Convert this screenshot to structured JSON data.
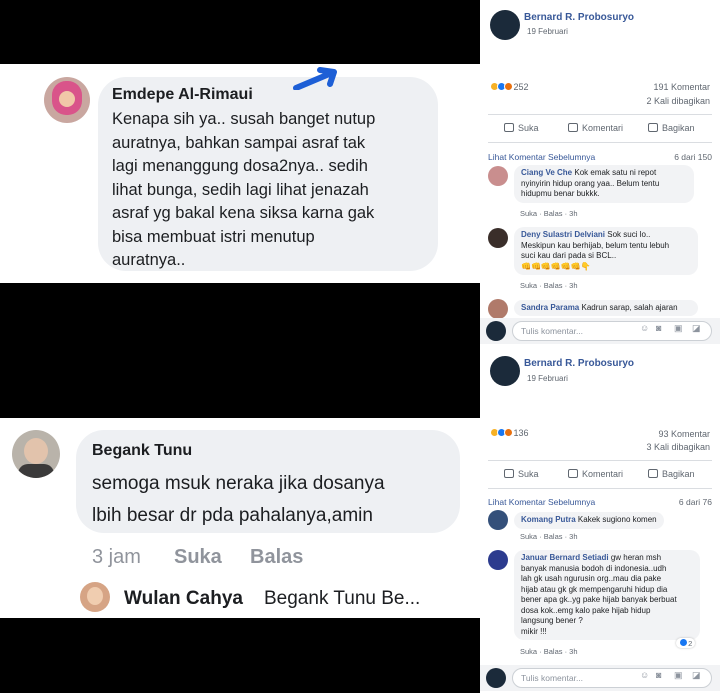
{
  "left_top": {
    "name": "Emdepe Al-Rimaui",
    "text": "Kenapa sih ya.. susah banget nutup\nauratnya, bahkan sampai asraf tak\nlagi menanggung dosa2nya.. sedih\nlihat bunga, sedih lagi lihat jenazah\nasraf yg bakal kena siksa karna gak\nbisa membuat istri menutup\nauratnya.."
  },
  "left_bottom": {
    "name": "Begank Tunu",
    "text": "semoga msuk neraka jika dosanya\nlbih besar dr pda pahalanya,amin",
    "time": "3 jam",
    "like": "Suka",
    "reply": "Balas",
    "next_name": "Wulan Cahya",
    "next_text": "Begank Tunu Be..."
  },
  "posts": [
    {
      "author": "Bernard R. Probosuryo",
      "date": "19 Februari",
      "reactions": "252",
      "comments": "191 Komentar",
      "shares": "2 Kali dibagikan",
      "like": "Suka",
      "comment": "Komentari",
      "share": "Bagikan",
      "prev": "Lihat Komentar Sebelumnya",
      "pages": "6 dari 150",
      "items": [
        {
          "name": "Ciang Ve Che",
          "text": "Kok emak satu ni repot\nnyinyirin hidup orang yaa.. Belum tentu\nhidupmu benar bukkk.",
          "meta": "Suka · Balas · 3h"
        },
        {
          "name": "Deny Sulastri Delviani",
          "text": "Sok suci lo..\nMeskipun kau berhijab, belum tentu lebuh\nsuci kau dari pada si BCL..\n👊👊👊👊👊👊👇",
          "meta": "Suka · Balas · 3h"
        },
        {
          "name": "Sandra Parama",
          "text": "Kadrun sarap, salah ajaran",
          "meta": ""
        }
      ],
      "write": "Tulis komentar..."
    },
    {
      "author": "Bernard R. Probosuryo",
      "date": "19 Februari",
      "reactions": "136",
      "comments": "93 Komentar",
      "shares": "3 Kali dibagikan",
      "like": "Suka",
      "comment": "Komentari",
      "share": "Bagikan",
      "prev": "Lihat Komentar Sebelumnya",
      "pages": "6 dari 76",
      "items": [
        {
          "name": "Komang Putra",
          "text": "Kakek sugiono komen",
          "meta": "Suka · Balas · 3h"
        },
        {
          "name": "Januar Bernard Setiadi",
          "text": "gw heran msh\nbanyak manusia bodoh di indonesia..udh\nlah gk usah ngurusin org..mau dia pake\nhijab atau gk gk mempengaruhi hidup dia\nbener apa gk..yg pake hijab banyak berbuat\ndosa kok..emg kalo pake hijab hidup\nlangsung bener ?\nmikir !!!",
          "meta": "Suka · Balas · 3h",
          "likes": "2"
        }
      ],
      "write": "Tulis komentar..."
    }
  ]
}
